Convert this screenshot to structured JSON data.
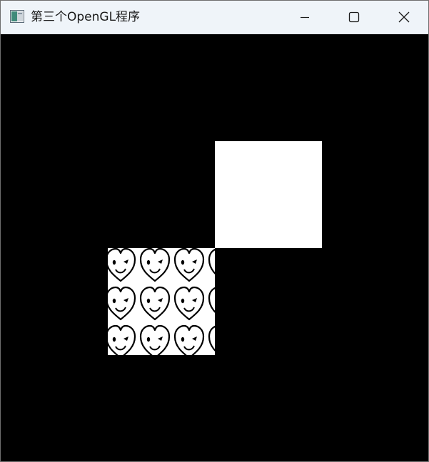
{
  "window": {
    "title": "第三个OpenGL程序",
    "app_icon": "app-window-icon",
    "controls": {
      "minimize": "minimize-icon",
      "maximize": "maximize-icon",
      "close": "close-icon"
    }
  },
  "canvas": {
    "background": "#000000",
    "quads": [
      {
        "name": "white-square",
        "fill": "#ffffff"
      },
      {
        "name": "textured-square",
        "texture": "smiling-heart-pattern",
        "fill": "#ffffff",
        "ink": "#000000"
      }
    ]
  }
}
